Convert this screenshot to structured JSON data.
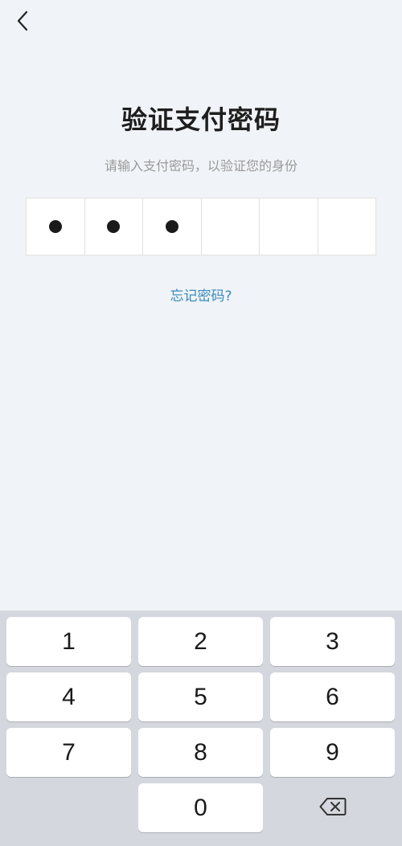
{
  "header": {
    "back_icon": "chevron-left-icon"
  },
  "main": {
    "title": "验证支付密码",
    "subtitle": "请输入支付密码，以验证您的身份",
    "pin": {
      "length": 6,
      "filled": 3
    },
    "forgot_link": "忘记密码?"
  },
  "keypad": {
    "keys": [
      "1",
      "2",
      "3",
      "4",
      "5",
      "6",
      "7",
      "8",
      "9",
      "0"
    ],
    "backspace_icon": "backspace-icon"
  },
  "colors": {
    "background": "#f0f3f7",
    "link": "#3a8bbd",
    "keypad_background": "#d4d7dd"
  }
}
